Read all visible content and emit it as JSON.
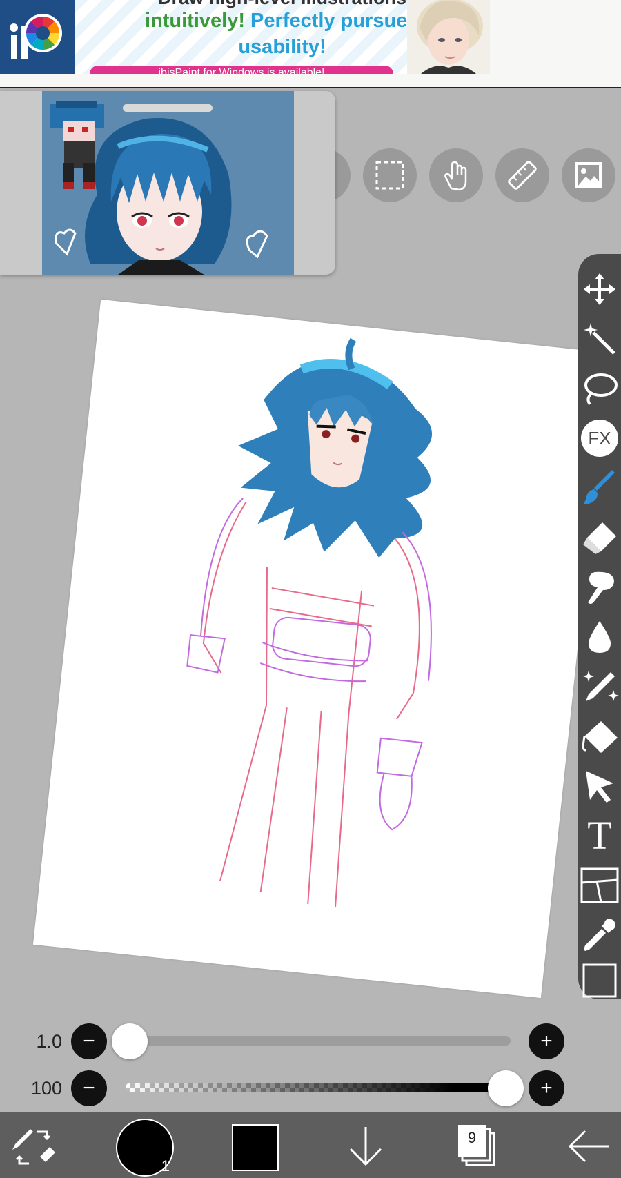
{
  "ad": {
    "line0": "Draw high-level illustrations",
    "line1_a": "intuitively!",
    "line1_b": "Perfectly pursued",
    "line2": "usability!",
    "pink_text": "ibisPaint for Windows is available!"
  },
  "reference": {
    "name": "reference-window"
  },
  "top_toolbar": [
    {
      "icon": "selection-icon"
    },
    {
      "icon": "hand-pan-icon"
    },
    {
      "icon": "ruler-icon"
    },
    {
      "icon": "image-icon"
    }
  ],
  "tools": [
    "move-icon",
    "magic-wand-icon",
    "lasso-icon",
    "fx-icon",
    "brush-icon",
    "eraser-icon",
    "smudge-icon",
    "blur-icon",
    "special-pen-icon",
    "fill-icon",
    "select-arrow-icon",
    "text-icon",
    "frame-divider-icon",
    "eyedropper-icon",
    "canvas-icon"
  ],
  "fx_label": "FX",
  "text_tool_label": "T",
  "sliders": {
    "size": {
      "value": "1.0",
      "level": 0.0
    },
    "opacity": {
      "value": "100",
      "level": 1.0
    }
  },
  "bottom": {
    "brush_size_badge": "1",
    "layers_count": "9",
    "primary_color": "#000000",
    "secondary_color": "#000000"
  },
  "colors": {
    "accent_blue": "#2f8fd8",
    "panel_dark": "#4a4a4a",
    "bottom_bar": "#5e5e5e"
  }
}
